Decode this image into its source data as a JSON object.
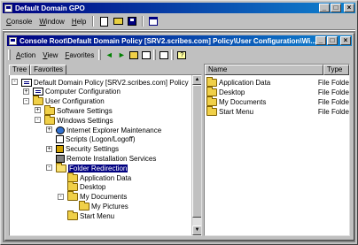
{
  "app": {
    "title": "Default Domain GPO",
    "menu": [
      {
        "key": "C",
        "rest": "onsole"
      },
      {
        "key": "W",
        "rest": "indow"
      },
      {
        "key": "H",
        "rest": "elp"
      }
    ]
  },
  "child": {
    "title": "Console Root\\Default Domain Policy [SRV2.scribes.com] Policy\\User Configuration\\Wi...",
    "menu": [
      {
        "key": "A",
        "rest": "ction"
      },
      {
        "key": "V",
        "rest": "iew"
      },
      {
        "key": "F",
        "rest": "avorites"
      }
    ]
  },
  "tabs": [
    "Tree",
    "Favorites"
  ],
  "tree": [
    {
      "label": "Default Domain Policy [SRV2.scribes.com] Policy",
      "icon": "policy",
      "level": 0,
      "exp": "-"
    },
    {
      "label": "Computer Configuration",
      "icon": "computer",
      "level": 1,
      "exp": "+"
    },
    {
      "label": "User Configuration",
      "icon": "user",
      "level": 1,
      "exp": "-"
    },
    {
      "label": "Software Settings",
      "icon": "folder",
      "level": 2,
      "exp": "+"
    },
    {
      "label": "Windows Settings",
      "icon": "folder",
      "level": 2,
      "exp": "-"
    },
    {
      "label": "Internet Explorer Maintenance",
      "icon": "globe",
      "level": 3,
      "exp": "+"
    },
    {
      "label": "Scripts (Logon/Logoff)",
      "icon": "script",
      "level": 3,
      "exp": ""
    },
    {
      "label": "Security Settings",
      "icon": "lock",
      "level": 3,
      "exp": "+"
    },
    {
      "label": "Remote Installation Services",
      "icon": "remote",
      "level": 3,
      "exp": ""
    },
    {
      "label": "Folder Redirection",
      "icon": "open",
      "level": 3,
      "exp": "-",
      "selected": true
    },
    {
      "label": "Application Data",
      "icon": "folder",
      "level": 4,
      "exp": ""
    },
    {
      "label": "Desktop",
      "icon": "folder",
      "level": 4,
      "exp": ""
    },
    {
      "label": "My Documents",
      "icon": "folder",
      "level": 4,
      "exp": "-"
    },
    {
      "label": "My Pictures",
      "icon": "folder",
      "level": 5,
      "exp": ""
    },
    {
      "label": "Start Menu",
      "icon": "folder",
      "level": 4,
      "exp": ""
    }
  ],
  "list": {
    "columns": [
      "Name",
      "Type"
    ],
    "rows": [
      {
        "name": "Application Data",
        "type": "File Folder"
      },
      {
        "name": "Desktop",
        "type": "File Folder"
      },
      {
        "name": "My Documents",
        "type": "File Folder"
      },
      {
        "name": "Start Menu",
        "type": "File Folder"
      }
    ]
  },
  "colors": {
    "titlebar": "#000080",
    "selection": "#000080",
    "face": "#c0c0c0"
  }
}
